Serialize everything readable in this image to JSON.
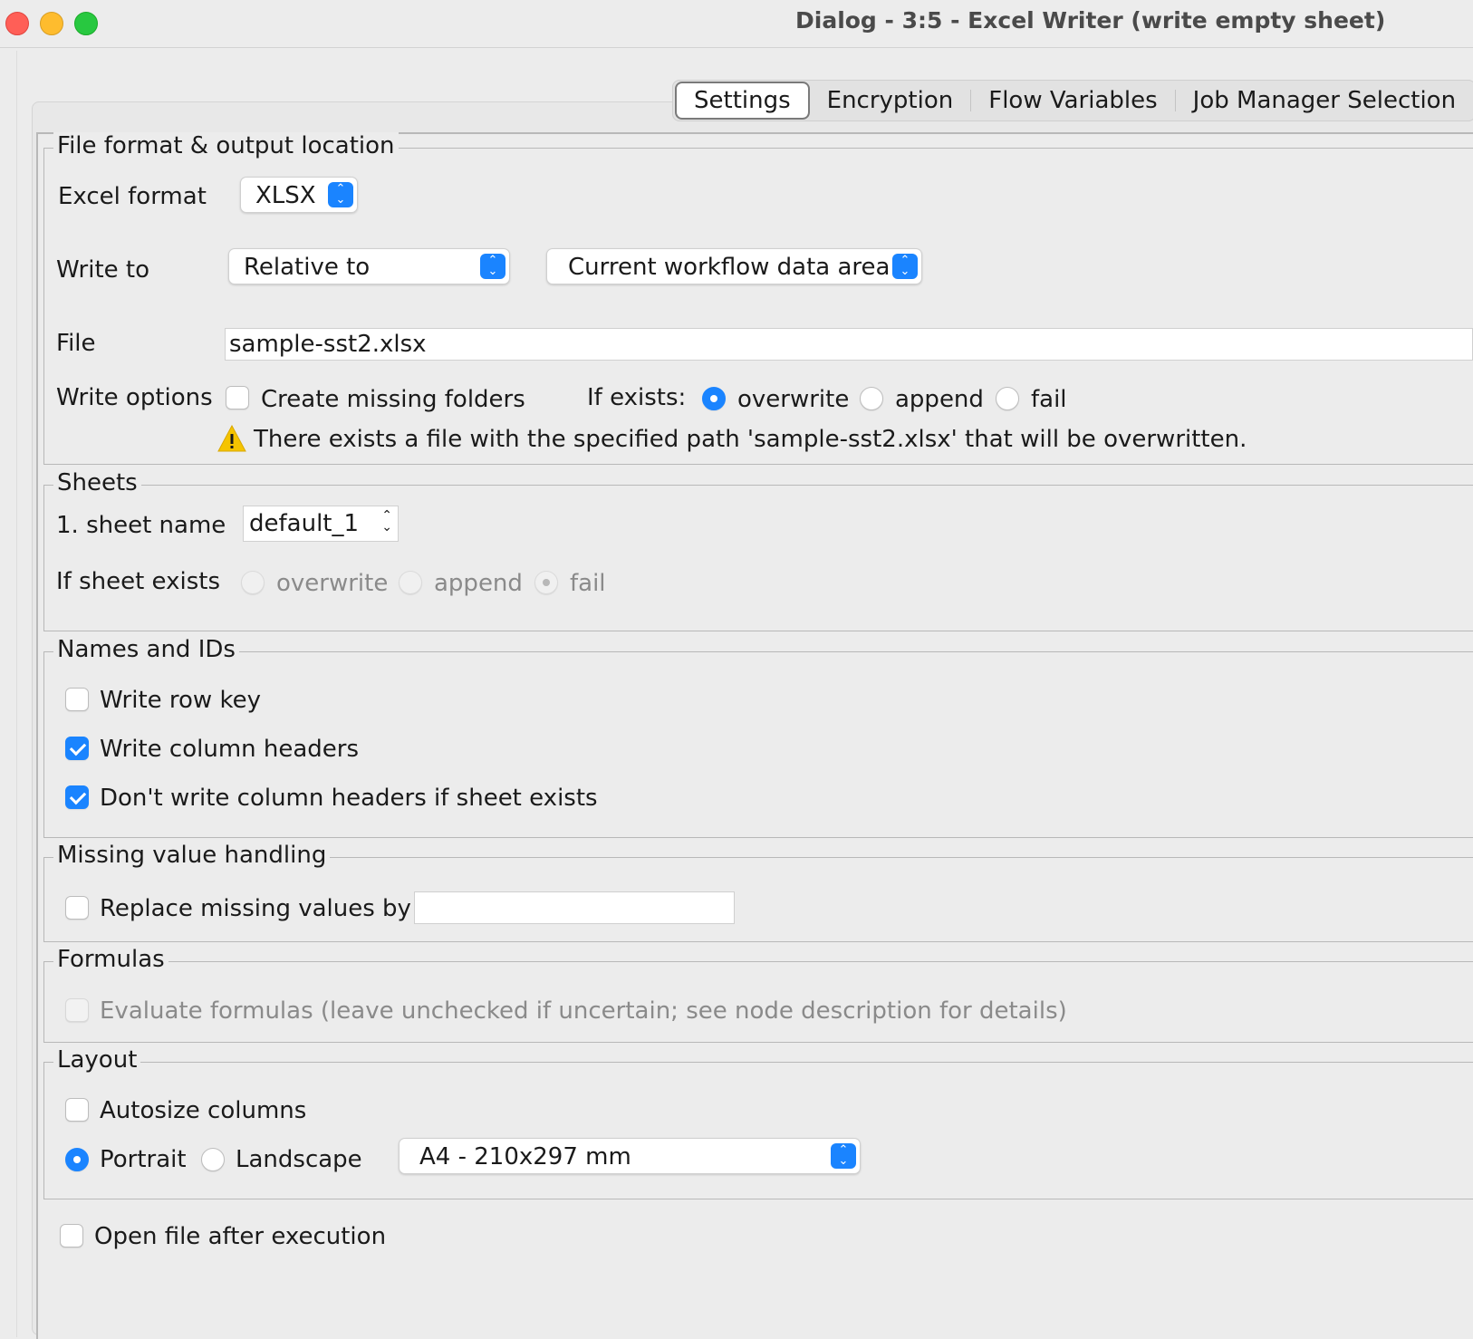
{
  "window": {
    "title": "Dialog - 3:5 - Excel Writer (write empty sheet)"
  },
  "tabs": [
    {
      "label": "Settings",
      "active": true
    },
    {
      "label": "Encryption"
    },
    {
      "label": "Flow Variables"
    },
    {
      "label": "Job Manager Selection"
    }
  ],
  "file_format": {
    "legend": "File format & output location",
    "excel_format_label": "Excel format",
    "excel_format_value": "XLSX",
    "write_to_label": "Write to",
    "write_to_value": "Relative to",
    "relative_location_value": "Current workflow data area",
    "file_label": "File",
    "file_value": "sample-sst2.xlsx",
    "write_options_label": "Write options",
    "create_missing_folders_label": "Create missing folders",
    "if_exists_label": "If exists:",
    "if_exists_options": [
      "overwrite",
      "append",
      "fail"
    ],
    "if_exists_selected": "overwrite",
    "warning_text": "There exists a file with the specified path 'sample-sst2.xlsx' that will be overwritten."
  },
  "sheets": {
    "legend": "Sheets",
    "sheet_name_label": "1. sheet name",
    "sheet_name_value": "default_1",
    "if_sheet_exists_label": "If sheet exists",
    "options": [
      "overwrite",
      "append",
      "fail"
    ],
    "selected": "fail"
  },
  "names_ids": {
    "legend": "Names and IDs",
    "write_row_key": "Write row key",
    "write_column_headers": "Write column headers",
    "dont_write_headers": "Don't write column headers if sheet exists"
  },
  "missing_values": {
    "legend": "Missing value handling",
    "replace_label": "Replace missing values by",
    "replace_value": ""
  },
  "formulas": {
    "legend": "Formulas",
    "evaluate_label": "Evaluate formulas (leave unchecked if uncertain; see node description for details)"
  },
  "layout": {
    "legend": "Layout",
    "autosize_label": "Autosize columns",
    "portrait_label": "Portrait",
    "landscape_label": "Landscape",
    "paper_size_value": "A4 - 210x297 mm"
  },
  "open_after_execution_label": "Open file after execution",
  "colors": {
    "accent": "#1a84ff",
    "warning": "#f5c400"
  }
}
